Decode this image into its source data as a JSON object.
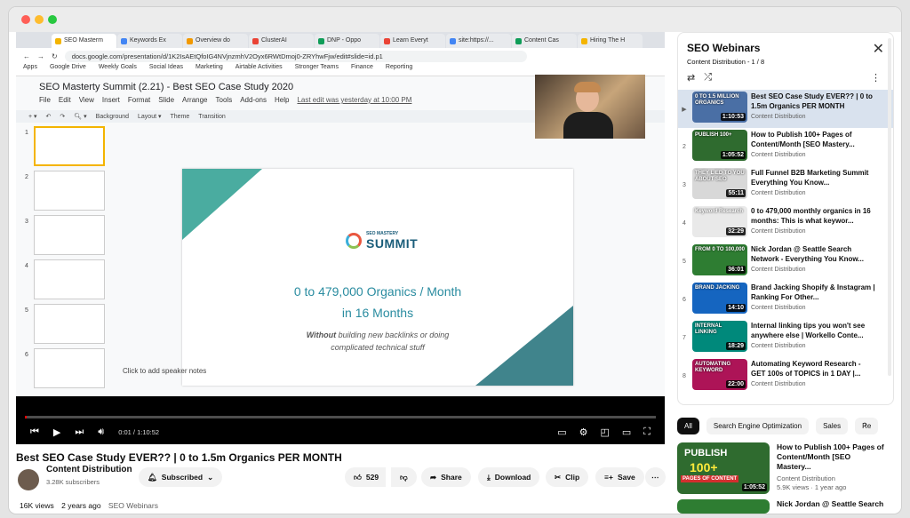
{
  "browser_tabs": [
    "SEO Masterm",
    "Keywords Ex",
    "Overview do",
    "ClusterAI",
    "DNP - Oppo",
    "Learn Everyt",
    "site:https://...",
    "Content Cas",
    "Hiring The H"
  ],
  "url": "docs.google.com/presentation/d/1K2IsAEtQfoIG4NVjnzmhV2Oyx6RWtDmoj0-ZRYhwFjw/edit#slide=id.p1",
  "bookmarks": [
    "Apps",
    "Google Drive",
    "Weekly Goals",
    "Social Ideas",
    "Marketing",
    "Airtable Activities",
    "Stronger Teams",
    "Finance",
    "Reporting"
  ],
  "slides": {
    "doc_title": "SEO Masterty Summit (2.21) - Best SEO Case Study 2020",
    "menus": [
      "File",
      "Edit",
      "View",
      "Insert",
      "Format",
      "Slide",
      "Arrange",
      "Tools",
      "Add-ons",
      "Help"
    ],
    "last_edit": "Last edit was yesterday at 10:00 PM",
    "toolbar": [
      "Background",
      "Layout ▾",
      "Theme",
      "Transition"
    ],
    "thumb_numbers": [
      "1",
      "2",
      "3",
      "4",
      "5",
      "6"
    ],
    "logo_small": "SEO MASTERY",
    "logo_big": "SUMMIT",
    "headline1": "0 to 479,000 Organics / Month",
    "headline2": "in 16 Months",
    "sub_bold": "Without",
    "sub1_rest": " building new backlinks or doing",
    "sub2": "complicated technical stuff",
    "speaker_notes": "Click to add speaker notes"
  },
  "player": {
    "time": "0:01 / 1:10:52",
    "progress": 0.001
  },
  "video": {
    "title": "Best SEO Case Study EVER?? | 0 to 1.5m Organics PER MONTH",
    "channel": "Content Distribution",
    "subscribers": "3.28K subscribers",
    "subscribed_label": "Subscribed",
    "likes": "529",
    "share_label": "Share",
    "download_label": "Download",
    "clip_label": "Clip",
    "save_label": "Save",
    "views": "16K views",
    "age": "2 years ago",
    "playlist_link": "SEO Webinars"
  },
  "playlist": {
    "title": "SEO Webinars",
    "subtitle": "Content Distribution - 1 / 8",
    "items": [
      {
        "idx": "▶",
        "title": "Best SEO Case Study EVER?? | 0 to 1.5m Organics PER MONTH",
        "channel": "Content Distribution",
        "duration": "1:10:53",
        "thumb": "#4a6fa5"
      },
      {
        "idx": "2",
        "title": "How to Publish 100+ Pages of Content/Month [SEO Mastery...",
        "channel": "Content Distribution",
        "duration": "1:05:52",
        "thumb": "#2f6b2f"
      },
      {
        "idx": "3",
        "title": "Full Funnel B2B Marketing Summit Everything You Know...",
        "channel": "Content Distribution",
        "duration": "55:11",
        "thumb": "#d8d8d8"
      },
      {
        "idx": "4",
        "title": "0 to 479,000 monthly organics in 16 months: This is what keywor...",
        "channel": "Content Distribution",
        "duration": "32:29",
        "thumb": "#e9e9e9"
      },
      {
        "idx": "5",
        "title": "Nick Jordan @ Seattle Search Network - Everything You Know...",
        "channel": "Content Distribution",
        "duration": "36:01",
        "thumb": "#2e7d32"
      },
      {
        "idx": "6",
        "title": "Brand Jacking Shopify & Instagram | Ranking For Other...",
        "channel": "Content Distribution",
        "duration": "14:10",
        "thumb": "#1565c0"
      },
      {
        "idx": "7",
        "title": "Internal linking tips you won't see anywhere else | Workello Conte...",
        "channel": "Content Distribution",
        "duration": "18:29",
        "thumb": "#00897b"
      },
      {
        "idx": "8",
        "title": "Automating Keyword Research - GET 100s of TOPICS in 1 DAY |...",
        "channel": "Content Distribution",
        "duration": "22:00",
        "thumb": "#ad1457"
      }
    ]
  },
  "chips": [
    "All",
    "Search Engine Optimization",
    "Sales",
    "Re"
  ],
  "recommendations": [
    {
      "title": "How to Publish 100+ Pages of Content/Month [SEO Mastery...",
      "channel": "Content Distribution",
      "meta": "5.9K views · 1 year ago",
      "duration": "1:05:52",
      "thumb_text1": "PUBLISH",
      "thumb_text2": "100+",
      "thumb_text3": "PAGES OF CONTENT"
    },
    {
      "title": "Nick Jordan @ Seattle Search",
      "channel": "",
      "meta": "",
      "duration": "",
      "thumb_text1": "",
      "thumb_text2": "",
      "thumb_text3": ""
    }
  ],
  "pl_thumb_texts": [
    "0 TO 1.5 MILLION ORGANICS",
    "PUBLISH 100+",
    "THEY LIED TO YOU ABOUT SEO",
    "Keyword Research",
    "FROM 0 TO 100,000",
    "BRAND JACKING",
    "INTERNAL LINKING",
    "AUTOMATING KEYWORD"
  ]
}
